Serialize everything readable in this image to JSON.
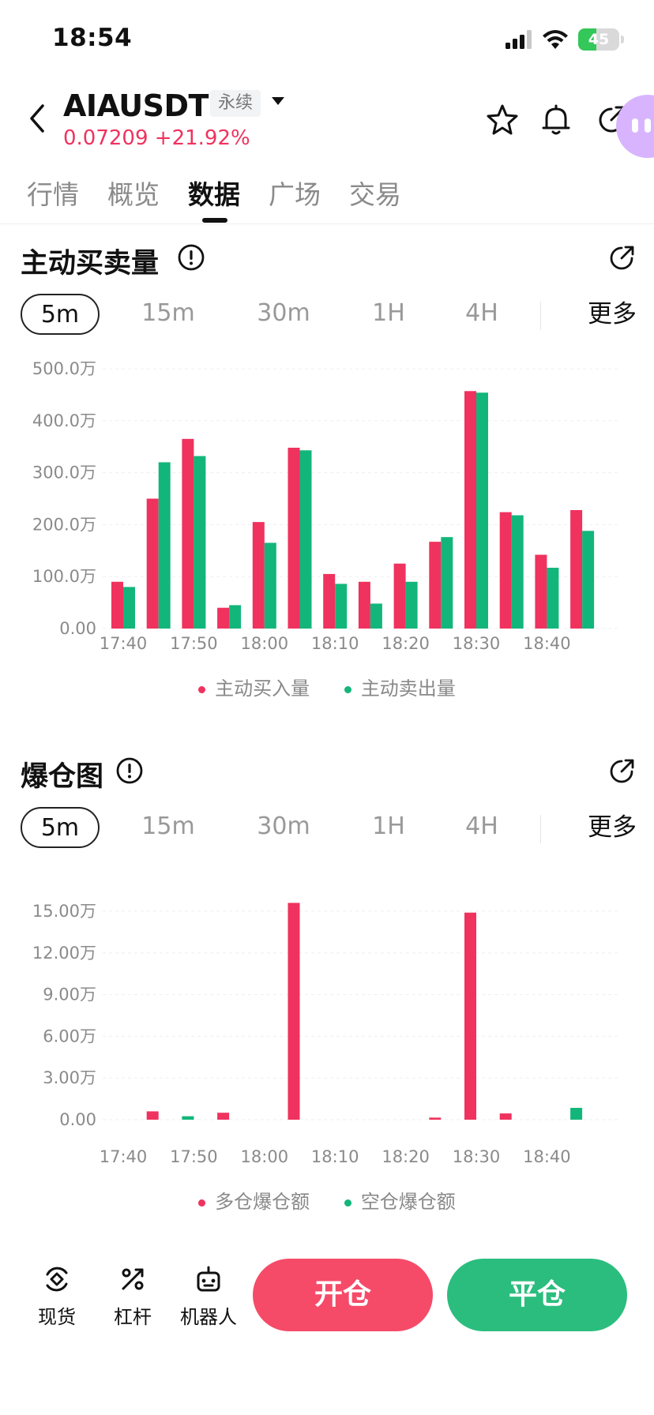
{
  "status_bar": {
    "time": "18:54",
    "battery": "45",
    "battery_level": 0.45
  },
  "header": {
    "symbol": "AIAUSDT",
    "contract_type": "永续",
    "price": "0.07209",
    "change": "+21.92%",
    "icons": [
      "back-icon",
      "chevron-down-icon",
      "star-icon",
      "bell-icon",
      "share-icon"
    ]
  },
  "tabs": [
    {
      "label": "行情",
      "active": false
    },
    {
      "label": "概览",
      "active": false
    },
    {
      "label": "数据",
      "active": true
    },
    {
      "label": "广场",
      "active": false
    },
    {
      "label": "交易",
      "active": false
    }
  ],
  "colors": {
    "buy": "#f0325e",
    "sell": "#13b67a",
    "open_btn": "#f54b68",
    "close_btn": "#2bbd7e"
  },
  "sections": [
    {
      "title": "主动买卖量",
      "intervals": [
        "5m",
        "15m",
        "30m",
        "1H",
        "4H"
      ],
      "active_interval": "5m",
      "more": "更多",
      "legend": [
        "主动买入量",
        "主动卖出量"
      ]
    },
    {
      "title": "爆仓图",
      "intervals": [
        "5m",
        "15m",
        "30m",
        "1H",
        "4H"
      ],
      "active_interval": "5m",
      "more": "更多",
      "legend": [
        "多仓爆仓额",
        "空仓爆仓额"
      ]
    }
  ],
  "chart_data": [
    {
      "type": "bar",
      "title": "主动买卖量",
      "unit": "万",
      "ylim": [
        0,
        500
      ],
      "y_ticks": [
        "0.00",
        "100.0万",
        "200.0万",
        "300.0万",
        "400.0万",
        "500.0万"
      ],
      "x_ticks": [
        "17:40",
        "17:50",
        "18:00",
        "18:10",
        "18:20",
        "18:30",
        "18:40"
      ],
      "grid": true,
      "legend_placement": "bottom",
      "categories": [
        "17:40",
        "17:45",
        "17:50",
        "17:55",
        "18:00",
        "18:05",
        "18:10",
        "18:15",
        "18:20",
        "18:25",
        "18:30",
        "18:35",
        "18:40",
        "18:45"
      ],
      "series": [
        {
          "name": "主动买入量",
          "values": [
            90,
            250,
            365,
            40,
            205,
            348,
            105,
            90,
            125,
            167,
            457,
            224,
            142,
            228
          ]
        },
        {
          "name": "主动卖出量",
          "values": [
            80,
            320,
            332,
            45,
            165,
            343,
            86,
            48,
            90,
            176,
            454,
            218,
            117,
            188
          ]
        }
      ]
    },
    {
      "type": "bar",
      "title": "爆仓图",
      "unit": "万",
      "ylim": [
        0,
        15
      ],
      "y_ticks": [
        "0.00",
        "3.00万",
        "6.00万",
        "9.00万",
        "12.00万",
        "15.00万"
      ],
      "x_ticks": [
        "17:40",
        "17:50",
        "18:00",
        "18:10",
        "18:20",
        "18:30",
        "18:40"
      ],
      "grid": true,
      "legend_placement": "bottom",
      "categories": [
        "17:40",
        "17:45",
        "17:50",
        "17:55",
        "18:00",
        "18:05",
        "18:10",
        "18:15",
        "18:20",
        "18:25",
        "18:30",
        "18:35",
        "18:40",
        "18:45"
      ],
      "series": [
        {
          "name": "多仓爆仓额",
          "values": [
            0,
            0.6,
            0,
            0.5,
            0,
            15.6,
            0,
            0,
            0,
            0.15,
            14.9,
            0.45,
            0,
            0
          ]
        },
        {
          "name": "空仓爆仓额",
          "values": [
            0,
            0,
            0.25,
            0,
            0,
            0,
            0,
            0,
            0,
            0,
            0,
            0,
            0,
            0.85
          ]
        }
      ]
    }
  ],
  "bottom_bar": {
    "items": [
      {
        "label": "现货",
        "icon": "spot-icon"
      },
      {
        "label": "杠杆",
        "icon": "leverage-icon"
      },
      {
        "label": "机器人",
        "icon": "robot-icon"
      }
    ],
    "open_label": "开仓",
    "close_label": "平仓"
  }
}
